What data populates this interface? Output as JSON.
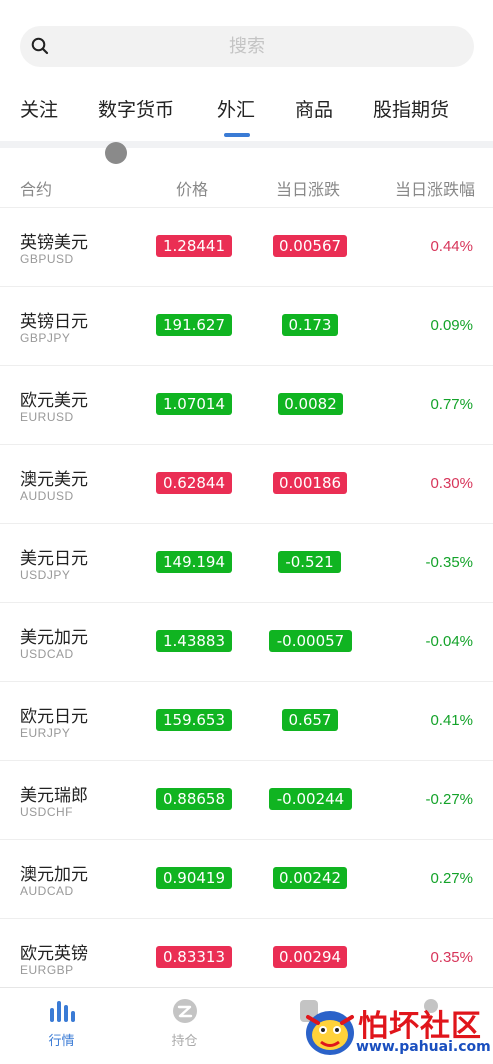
{
  "search": {
    "placeholder": "搜索"
  },
  "tabs": [
    {
      "label": "关注"
    },
    {
      "label": "数字货币"
    },
    {
      "label": "外汇",
      "active": true
    },
    {
      "label": "商品"
    },
    {
      "label": "股指期货"
    }
  ],
  "columns": {
    "contract": "合约",
    "price": "价格",
    "change": "当日涨跌",
    "change_pct": "当日涨跌幅"
  },
  "rows": [
    {
      "name": "英镑美元",
      "code": "GBPUSD",
      "price": "1.28441",
      "change": "0.00567",
      "pct": "0.44%",
      "dir": "up"
    },
    {
      "name": "英镑日元",
      "code": "GBPJPY",
      "price": "191.627",
      "change": "0.173",
      "pct": "0.09%",
      "dir": "down"
    },
    {
      "name": "欧元美元",
      "code": "EURUSD",
      "price": "1.07014",
      "change": "0.0082",
      "pct": "0.77%",
      "dir": "down"
    },
    {
      "name": "澳元美元",
      "code": "AUDUSD",
      "price": "0.62844",
      "change": "0.00186",
      "pct": "0.30%",
      "dir": "up"
    },
    {
      "name": "美元日元",
      "code": "USDJPY",
      "price": "149.194",
      "change": "-0.521",
      "pct": "-0.35%",
      "dir": "down"
    },
    {
      "name": "美元加元",
      "code": "USDCAD",
      "price": "1.43883",
      "change": "-0.00057",
      "pct": "-0.04%",
      "dir": "down"
    },
    {
      "name": "欧元日元",
      "code": "EURJPY",
      "price": "159.653",
      "change": "0.657",
      "pct": "0.41%",
      "dir": "down"
    },
    {
      "name": "美元瑞郎",
      "code": "USDCHF",
      "price": "0.88658",
      "change": "-0.00244",
      "pct": "-0.27%",
      "dir": "down"
    },
    {
      "name": "澳元加元",
      "code": "AUDCAD",
      "price": "0.90419",
      "change": "0.00242",
      "pct": "0.27%",
      "dir": "down"
    },
    {
      "name": "欧元英镑",
      "code": "EURGBP",
      "price": "0.83313",
      "change": "0.00294",
      "pct": "0.35%",
      "dir": "up"
    }
  ],
  "nav": [
    {
      "label": "行情",
      "icon": "bar-chart-icon",
      "active": true
    },
    {
      "label": "持仓",
      "icon": "position-icon"
    }
  ],
  "watermark": {
    "text": "怕坏社区",
    "url": "www.pahuai.com"
  },
  "colors": {
    "up": "#ea2e54",
    "down": "#10b421",
    "accent": "#3a7bd5"
  }
}
